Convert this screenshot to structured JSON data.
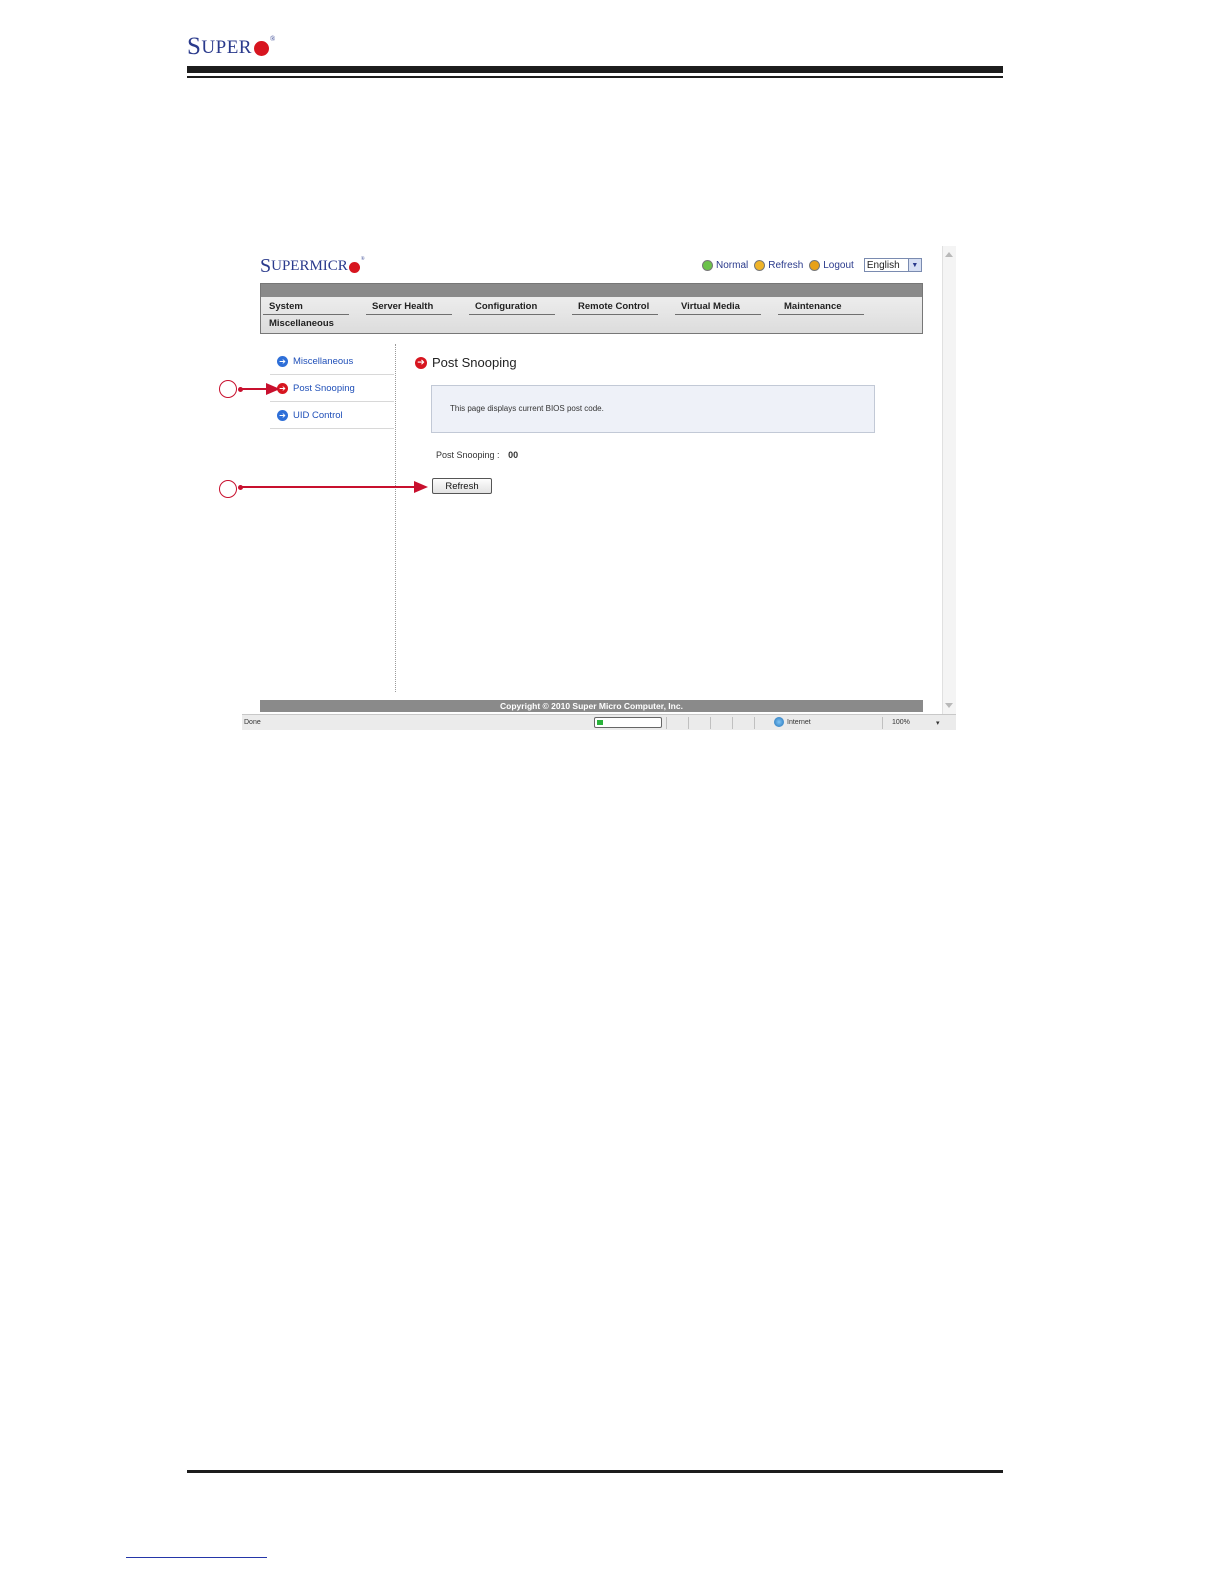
{
  "document": {
    "header_logo": {
      "first": "S",
      "rest": "UPER",
      "reg": "®"
    }
  },
  "app": {
    "logo": {
      "first": "S",
      "rest": "UPERMICR",
      "reg": "®"
    },
    "top_actions": [
      {
        "label": "Normal",
        "icon": "check-icon"
      },
      {
        "label": "Refresh",
        "icon": "refresh-icon"
      },
      {
        "label": "Logout",
        "icon": "logout-icon"
      }
    ],
    "language": {
      "value": "English",
      "icon": "chevron-down-icon"
    },
    "menu": {
      "items": [
        "System",
        "Server Health",
        "Configuration",
        "Remote Control",
        "Virtual Media",
        "Maintenance"
      ],
      "submenu": "Miscellaneous"
    },
    "sidebar": {
      "items": [
        {
          "label": "Miscellaneous",
          "active": false
        },
        {
          "label": "Post Snooping",
          "active": true
        },
        {
          "label": "UID Control",
          "active": false
        }
      ]
    },
    "content": {
      "title": "Post Snooping",
      "info": "This page displays current BIOS post code.",
      "snoop_label": "Post Snooping :",
      "snoop_value": "00",
      "refresh_button": "Refresh"
    },
    "footer": {
      "copyright": "Copyright © 2010 Super Micro Computer, Inc."
    },
    "statusbar": {
      "left": "Done",
      "zone": "Internet",
      "zoom": "100%",
      "zoom_arrow": "▾",
      "progress": 0.1
    }
  },
  "colors": {
    "brand_blue": "#2a3a8c",
    "brand_red": "#d7151f",
    "callout_red": "#c8102e"
  }
}
